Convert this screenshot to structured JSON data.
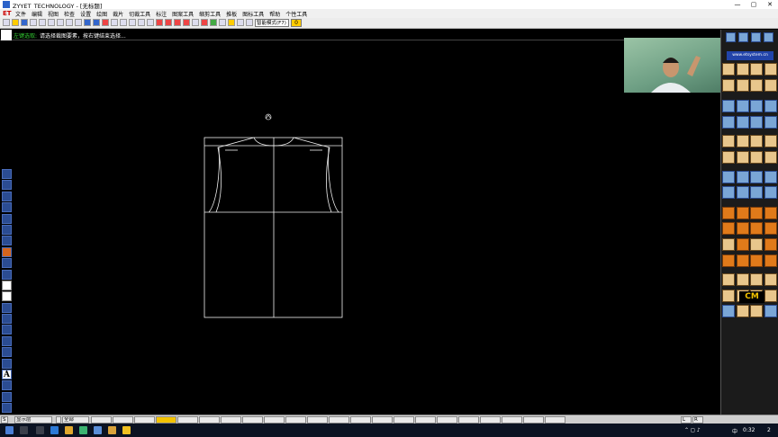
{
  "window": {
    "title": "ZYYET_TECHNOLOGY - [无标题]",
    "controls": [
      "—",
      "▢",
      "✕"
    ]
  },
  "menubar": {
    "logo": "ET",
    "items": [
      "文件",
      "编辑",
      "视图",
      "检查",
      "设置",
      "绘图",
      "裁片",
      "切裁工具",
      "标注",
      "图案工具",
      "缩剪工具",
      "推板",
      "图标工具",
      "帮助",
      "个性工具"
    ]
  },
  "toolbar": {
    "mode_value": "智能模式(F7)",
    "num_value": "0"
  },
  "prompt": {
    "label": "左键选取:",
    "message": "请选择裁图要素，按右键结束选择..."
  },
  "tools": {
    "text_tool_glyph": "A"
  },
  "right_panel": {
    "site": "www.etsystem.cn",
    "cm_label": "CM"
  },
  "layer_bar": {
    "mode_key": "S",
    "layer_name": "显示层",
    "all_label": "全部",
    "right_l": "L",
    "right_r": "R"
  },
  "taskbar": {
    "time": "0:32",
    "ime": "中",
    "notifications": "2"
  },
  "colors": {
    "pattern_line": "#f0f0f0",
    "canvas_bg": "#000000",
    "accent_orange": "#e07a1a"
  }
}
